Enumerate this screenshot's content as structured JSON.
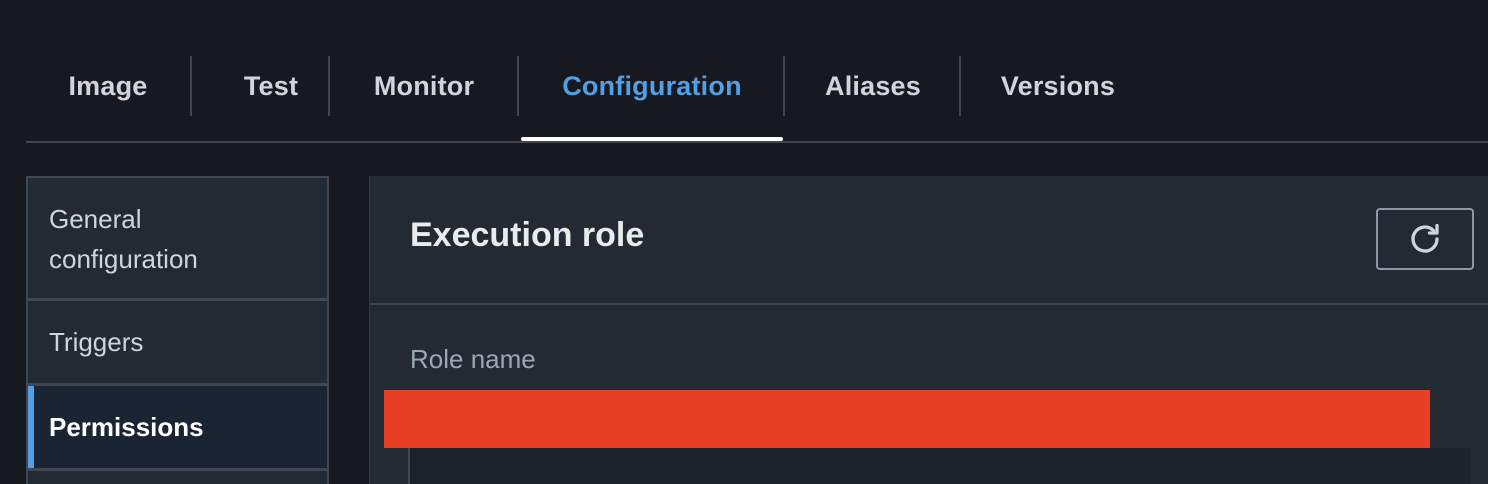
{
  "tabs": [
    {
      "label": "Image"
    },
    {
      "label": "Test"
    },
    {
      "label": "Monitor"
    },
    {
      "label": "Configuration",
      "active": true
    },
    {
      "label": "Aliases"
    },
    {
      "label": "Versions"
    }
  ],
  "sidenav": {
    "items": [
      {
        "label": "General configuration"
      },
      {
        "label": "Triggers"
      },
      {
        "label": "Permissions",
        "active": true
      }
    ]
  },
  "panel": {
    "title": "Execution role",
    "refresh_icon": "refresh-icon",
    "role_name_label": "Role name",
    "role_name_value_redacted": true
  },
  "colors": {
    "accent": "#539fe5",
    "background": "#16191f",
    "panel": "#232a33",
    "redaction": "#e63f24"
  }
}
